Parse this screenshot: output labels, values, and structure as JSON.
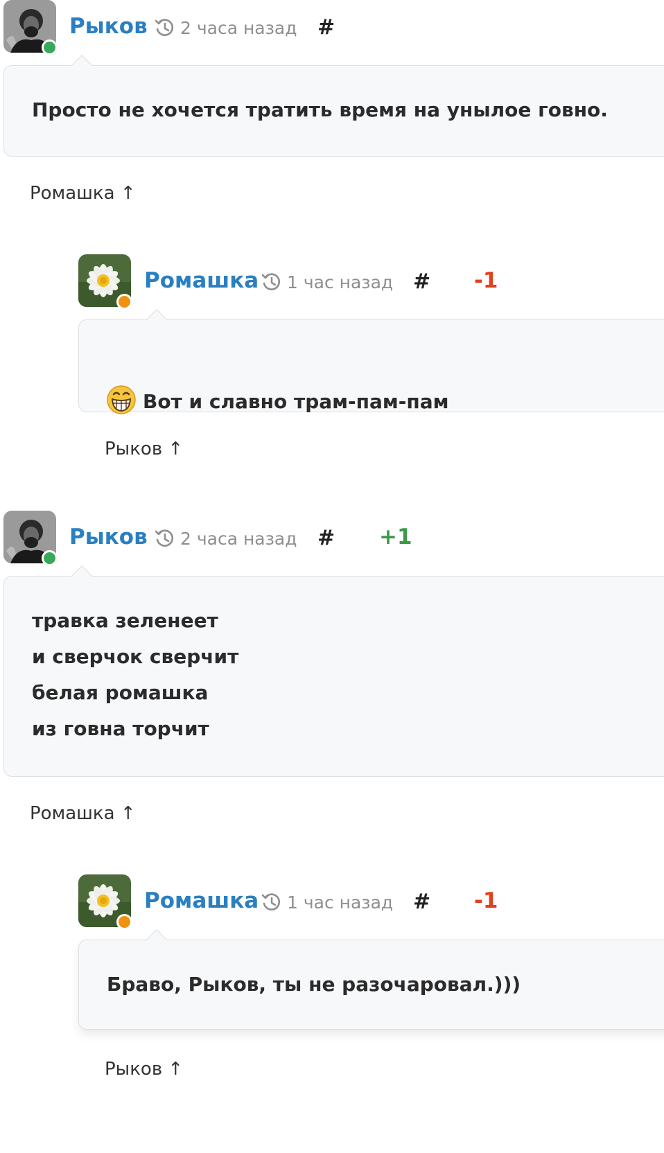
{
  "comments": [
    {
      "author": "Рыков",
      "time": "2 часа назад",
      "permalink": "#",
      "rating": "",
      "status_color": "#3aa85a",
      "text": "Просто не хочется тратить время на унылое говно.",
      "reply_to": "Ромашка ↑"
    },
    {
      "author": "Ромашка",
      "time": "1 час назад",
      "permalink": "#",
      "rating": "-1",
      "status_color": "#f0920f",
      "text": "Вот и славно трам-пам-пам",
      "reply_to": "Рыков ↑"
    },
    {
      "author": "Рыков",
      "time": "2 часа назад",
      "permalink": "#",
      "rating": "+1",
      "status_color": "#3aa85a",
      "text": "травка зеленеет\nи сверчок сверчит\nбелая ромашка\nиз говна торчит",
      "reply_to": "Ромашка ↑"
    },
    {
      "author": "Ромашка",
      "time": "1 час назад",
      "permalink": "#",
      "rating": "-1",
      "status_color": "#f0920f",
      "text": "Браво, Рыков, ты не разочаровал.)))",
      "reply_to": "Рыков ↑"
    }
  ]
}
